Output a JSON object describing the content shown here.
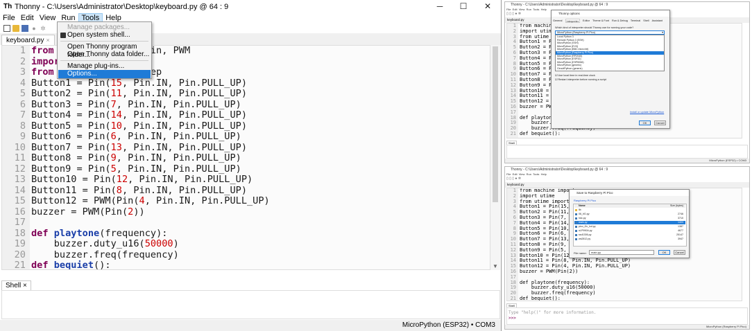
{
  "main": {
    "title": "Thonny  -  C:\\Users\\Administrator\\Desktop\\keyboard.py  @  64 : 9",
    "logo": "Th",
    "controls": {
      "minimize": "─",
      "maximize": "☐",
      "close": "✕"
    },
    "menu": [
      "File",
      "Edit",
      "View",
      "Run",
      "Tools",
      "Help"
    ],
    "toolbar_icons": [
      "new-file-icon",
      "open-file-icon",
      "save-icon",
      "run-icon",
      "debug-icon"
    ],
    "tab": {
      "label": "keyboard.py",
      "close": "×"
    },
    "line_numbers": [
      "1",
      "2",
      "3",
      "4",
      "5",
      "6",
      "7",
      "8",
      "9",
      "10",
      "11",
      "12",
      "13",
      "14",
      "15",
      "16",
      "17",
      "18",
      "19",
      "20",
      "21"
    ],
    "code": [
      [
        {
          "t": "from ",
          "c": "kw"
        },
        {
          "t": "machine import Pin, PWM",
          "c": ""
        }
      ],
      [
        {
          "t": "import",
          "c": "kw"
        },
        {
          "t": " utime",
          "c": ""
        }
      ],
      [
        {
          "t": "from ",
          "c": "kw"
        },
        {
          "t": "utime import sleep",
          "c": ""
        }
      ],
      [
        {
          "t": "Button1 = Pin(",
          "c": ""
        },
        {
          "t": "15",
          "c": "num"
        },
        {
          "t": ", Pin.IN, Pin.PULL_UP)",
          "c": ""
        }
      ],
      [
        {
          "t": "Button2 = Pin(",
          "c": ""
        },
        {
          "t": "11",
          "c": "num"
        },
        {
          "t": ", Pin.IN, Pin.PULL_UP)",
          "c": ""
        }
      ],
      [
        {
          "t": "Button3 = Pin(",
          "c": ""
        },
        {
          "t": "7",
          "c": "num"
        },
        {
          "t": ", Pin.IN, Pin.PULL_UP)",
          "c": ""
        }
      ],
      [
        {
          "t": "Button4 = Pin(",
          "c": ""
        },
        {
          "t": "14",
          "c": "num"
        },
        {
          "t": ", Pin.IN, Pin.PULL_UP)",
          "c": ""
        }
      ],
      [
        {
          "t": "Button5 = Pin(",
          "c": ""
        },
        {
          "t": "10",
          "c": "num"
        },
        {
          "t": ", Pin.IN, Pin.PULL_UP)",
          "c": ""
        }
      ],
      [
        {
          "t": "Button6 = Pin(",
          "c": ""
        },
        {
          "t": "6",
          "c": "num"
        },
        {
          "t": ", Pin.IN, Pin.PULL_UP)",
          "c": ""
        }
      ],
      [
        {
          "t": "Button7 = Pin(",
          "c": ""
        },
        {
          "t": "13",
          "c": "num"
        },
        {
          "t": ", Pin.IN, Pin.PULL_UP)",
          "c": ""
        }
      ],
      [
        {
          "t": "Button8 = Pin(",
          "c": ""
        },
        {
          "t": "9",
          "c": "num"
        },
        {
          "t": ", Pin.IN, Pin.PULL_UP)",
          "c": ""
        }
      ],
      [
        {
          "t": "Button9 = Pin(",
          "c": ""
        },
        {
          "t": "5",
          "c": "num"
        },
        {
          "t": ", Pin.IN, Pin.PULL_UP)",
          "c": ""
        }
      ],
      [
        {
          "t": "Button10 = Pin(",
          "c": ""
        },
        {
          "t": "12",
          "c": "num"
        },
        {
          "t": ", Pin.IN, Pin.PULL_UP)",
          "c": ""
        }
      ],
      [
        {
          "t": "Button11 = Pin(",
          "c": ""
        },
        {
          "t": "8",
          "c": "num"
        },
        {
          "t": ", Pin.IN, Pin.PULL_UP)",
          "c": ""
        }
      ],
      [
        {
          "t": "Button12 = PWM(Pin(",
          "c": ""
        },
        {
          "t": "4",
          "c": "num"
        },
        {
          "t": ", Pin.IN, Pin.PULL_UP)",
          "c": ""
        }
      ],
      [
        {
          "t": "buzzer = PWM(Pin(",
          "c": ""
        },
        {
          "t": "2",
          "c": "num"
        },
        {
          "t": "))",
          "c": ""
        }
      ],
      [
        {
          "t": "",
          "c": ""
        }
      ],
      [
        {
          "t": "def ",
          "c": "kw"
        },
        {
          "t": "playtone",
          "c": "fn"
        },
        {
          "t": "(frequency):",
          "c": ""
        }
      ],
      [
        {
          "t": "    buzzer.duty_u16(",
          "c": ""
        },
        {
          "t": "50000",
          "c": "num"
        },
        {
          "t": ")",
          "c": ""
        }
      ],
      [
        {
          "t": "    buzzer.freq(frequency)",
          "c": ""
        }
      ],
      [
        {
          "t": "def ",
          "c": "kw"
        },
        {
          "t": "bequiet",
          "c": "fn"
        },
        {
          "t": "():",
          "c": ""
        }
      ]
    ],
    "tools_menu": {
      "manage_packages": "Manage packages...",
      "open_system_shell": "Open system shell...",
      "open_program_folder": "Open Thonny program folder...",
      "open_data_folder": "Open Thonny data folder...",
      "manage_plugins": "Manage plug-ins...",
      "options": "Options..."
    },
    "shell_tab": "Shell ×",
    "status": "MicroPython (ESP32)  •  COM3"
  },
  "top_right": {
    "title": "Thonny  -  C:\\Users\\Administrator\\Desktop\\keyboard.py  @  64 : 9",
    "menu": "File  Edit  View  Run  Tools  Help",
    "tab": "keyboard.py",
    "line_numbers": [
      "1",
      "2",
      "3",
      "4",
      "5",
      "6",
      "7",
      "8",
      "9",
      "10",
      "11",
      "12",
      "13",
      "14",
      "15",
      "16",
      "17",
      "18",
      "19",
      "20",
      "21"
    ],
    "code": [
      "from machine import",
      "import utime",
      "from utime import",
      "Button1 = Pin(",
      "Button2 = Pin(",
      "Button3 = Pin(",
      "Button4 = Pin(",
      "Button5 = Pin(",
      "Button6 = Pin(",
      "Button7 = Pin(",
      "Button8 = Pin(",
      "Button9 = Pin(",
      "Button10 = Pin",
      "Button11 = Pin",
      "Button12 = Pin",
      "buzzer = PWM(P",
      "",
      "def playtone(f",
      "    buzzer.dut",
      "    buzzer.freq(frequency)",
      "def bequiet():"
    ],
    "shell_tab": "Shell",
    "status": "MicroPython (ESP32)  •  COM3",
    "dialog": {
      "title": "Thonny options",
      "tabs": [
        "General",
        "Interpreter",
        "Editor",
        "Theme & Font",
        "Run & Debug",
        "Terminal",
        "Shell",
        "Assistant"
      ],
      "question": "Which kind of interpreter should Thonny use for running your code?",
      "selected": "MicroPython (Raspberry Pi Pico)",
      "options": [
        "Local Python 3",
        "Remote Python 3 (SSH)",
        "MicroPython (SSH)",
        "MicroPython (EV3)",
        "MicroPython (BBC micro:bit)",
        "MicroPython (Raspberry Pi Pico)",
        "MicroPython (RP2040)",
        "MicroPython (ESP32)",
        "MicroPython (ESP8266)",
        "MicroPython (generic)",
        "CircuitPython (generic)"
      ],
      "check1": "Use local time in real-time clock",
      "check2": "Restart interpreter before running a script",
      "link": "Install or update MicroPython",
      "ok": "OK",
      "cancel": "Cancel"
    }
  },
  "bottom_right": {
    "title": "Thonny  -  C:\\Users\\Administrator\\Desktop\\keyboard.py  @  64 : 9",
    "menu": "File  Edit  View  Run  Tools  Help",
    "tab": "keyboard.py",
    "line_numbers": [
      "1",
      "2",
      "3",
      "4",
      "5",
      "6",
      "7",
      "8",
      "9",
      "10",
      "11",
      "12",
      "13",
      "14",
      "15",
      "16",
      "17",
      "18",
      "19",
      "20",
      "21"
    ],
    "code": [
      "from machine import",
      "import utime",
      "from utime import sl",
      "Button1 = Pin(15, P",
      "Button2 = Pin(11, P",
      "Button3 = Pin(7, Pi",
      "Button4 = Pin(14, P",
      "Button5 = Pin(10, P",
      "Button6 = Pin(6, Pin",
      "Button7 = Pin(13, P",
      "Button8 = Pin(9, Pin",
      "Button9 = Pin(5, Pin",
      "Button10 = Pin(12, P",
      "Button11 = Pin(8, Pin.IN, Pin.PULL_UP)",
      "Button12 = Pin(4, Pin.IN, Pin.PULL_UP)",
      "buzzer = PWM(Pin(2))",
      "",
      "def playtone(frequency):",
      "    buzzer.duty_u16(50000)",
      "    buzzer.freq(frequency)",
      "def bequiet():"
    ],
    "shell_tab": "Shell",
    "shell_hint": "Type \"help()\" for more information.",
    "prompt": ">>>",
    "status": "MicroPython (Raspberry Pi Pico)",
    "dialog": {
      "title": "Save to Raspberry Pi Pico",
      "location": "Raspberry Pi Pico",
      "col_name": "Name",
      "col_size": "Size (bytes)",
      "files": [
        {
          "name": "lib",
          "size": ""
        },
        {
          "name": "06_IrD.py",
          "size": "2746"
        },
        {
          "name": "hdc.py",
          "size": "3710"
        },
        {
          "name": "main.py",
          "size": "1403"
        },
        {
          "name": "pico_i2c_lcd.py",
          "size": "1387"
        },
        {
          "name": "oLP990A.py",
          "size": "4677"
        },
        {
          "name": "ssd1306.py",
          "size": "25147"
        },
        {
          "name": "ws2812.py",
          "size": "3947"
        }
      ],
      "selected_index": 3,
      "file_name_label": "File name:",
      "file_name_value": "main.py",
      "ok": "OK",
      "cancel": "Cancel"
    }
  }
}
